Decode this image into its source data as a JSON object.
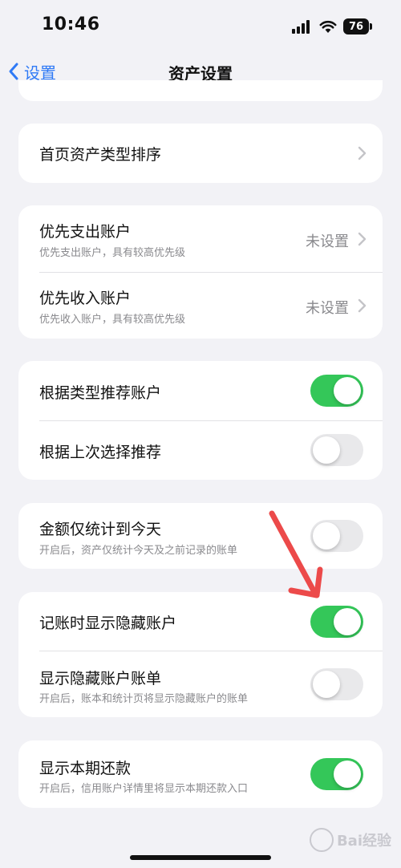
{
  "status_bar": {
    "time": "10:46",
    "battery": "76"
  },
  "nav": {
    "back_label": "设置",
    "title": "资产设置"
  },
  "sections": {
    "home_sort": {
      "title": "首页资产类型排序"
    },
    "priority_expense": {
      "title": "优先支出账户",
      "subtitle": "优先支出账户，具有较高优先级",
      "value": "未设置"
    },
    "priority_income": {
      "title": "优先收入账户",
      "subtitle": "优先收入账户，具有较高优先级",
      "value": "未设置"
    },
    "recommend_by_type": {
      "title": "根据类型推荐账户",
      "enabled": true
    },
    "recommend_by_last": {
      "title": "根据上次选择推荐",
      "enabled": false
    },
    "amount_until_today": {
      "title": "金额仅统计到今天",
      "subtitle": "开启后，资产仅统计今天及之前记录的账单",
      "enabled": false
    },
    "show_hidden_accounts": {
      "title": "记账时显示隐藏账户",
      "enabled": true
    },
    "show_hidden_bills": {
      "title": "显示隐藏账户账单",
      "subtitle": "开启后，账本和统计页将显示隐藏账户的账单",
      "enabled": false
    },
    "show_repayment": {
      "title": "显示本期还款",
      "subtitle": "开启后，信用账户详情里将显示本期还款入口",
      "enabled": true
    }
  },
  "colors": {
    "accent": "#2f7af6",
    "toggle_on": "#34c759",
    "toggle_off": "#e9e9eb",
    "annotation": "#ec4a4a"
  },
  "watermark": {
    "text": "Bai经验"
  }
}
